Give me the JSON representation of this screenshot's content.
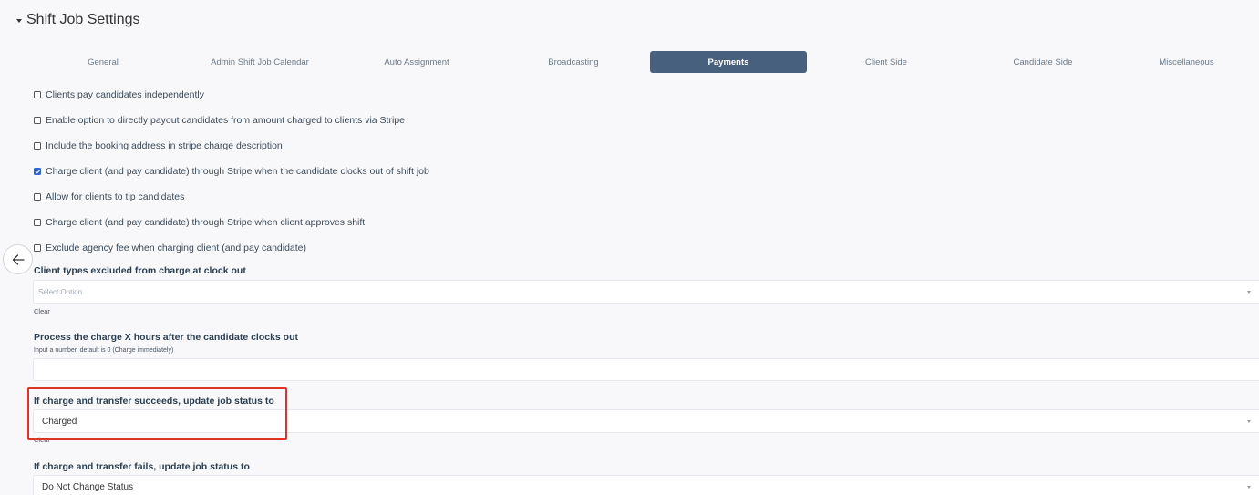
{
  "section": {
    "title": "Shift Job Settings"
  },
  "tabs": [
    {
      "label": "General"
    },
    {
      "label": "Admin Shift Job Calendar"
    },
    {
      "label": "Auto Assignment"
    },
    {
      "label": "Broadcasting"
    },
    {
      "label": "Payments",
      "active": true
    },
    {
      "label": "Client Side"
    },
    {
      "label": "Candidate Side"
    },
    {
      "label": "Miscellaneous"
    }
  ],
  "checkboxes": [
    {
      "label": "Clients pay candidates independently",
      "checked": false
    },
    {
      "label": "Enable option to directly payout candidates from amount charged to clients via Stripe",
      "checked": false
    },
    {
      "label": "Include the booking address in stripe charge description",
      "checked": false
    },
    {
      "label": "Charge client (and pay candidate) through Stripe when the candidate clocks out of shift job",
      "checked": true
    },
    {
      "label": "Allow for clients to tip candidates",
      "checked": false
    },
    {
      "label": "Charge client (and pay candidate) through Stripe when client approves shift",
      "checked": false
    },
    {
      "label": "Exclude agency fee when charging client (and pay candidate)",
      "checked": false
    }
  ],
  "client_types": {
    "label": "Client types excluded from charge at clock out",
    "placeholder": "Select Option",
    "clear_label": "Clear"
  },
  "process_delay": {
    "label": "Process the charge X hours after the candidate clocks out",
    "hint": "Input a number, default is 0 (Charge immediately)",
    "value": ""
  },
  "success_status": {
    "label": "If charge and transfer succeeds, update job status to",
    "value": "Charged",
    "clear_label": "Clear"
  },
  "fail_status": {
    "label": "If charge and transfer fails, update job status to",
    "value": "Do Not Change Status"
  },
  "colors": {
    "active_tab": "#46607d",
    "highlight": "#e0312b",
    "checkbox_checked": "#2f66d5"
  },
  "icons": {
    "collapse": "caret-down-icon",
    "back": "arrow-left-icon"
  }
}
